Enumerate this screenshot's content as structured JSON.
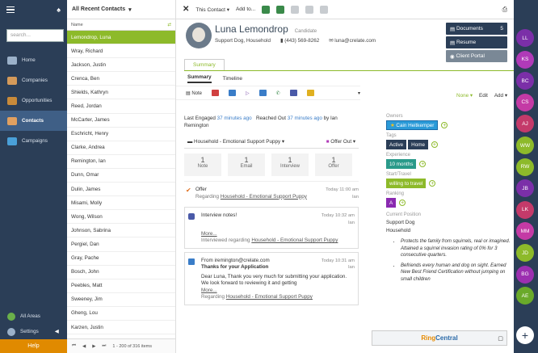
{
  "nav": {
    "search_placeholder": "search...",
    "items": [
      "Home",
      "Companies",
      "Opportunities",
      "Contacts",
      "Campaigns"
    ],
    "all_areas": "All Areas",
    "settings": "Settings",
    "help": "Help"
  },
  "list": {
    "title": "All Recent Contacts",
    "column": "Name",
    "rows": [
      "Lemondrop, Luna",
      "Wray, Richard",
      "Jackson, Justin",
      "Crenca, Ben",
      "Shields, Kathryn",
      "Reed, Jordan",
      "McCarter, James",
      "Eschricht, Henry",
      "Clarke, Andrea",
      "Remington, Ian",
      "Dunn, Omar",
      "Dulin, James",
      "Misami, Molly",
      "Wong, Wilson",
      "Johnson, Sabrina",
      "Pergiel, Dan",
      "Gray, Pache",
      "Bosch, John",
      "Peebles, Matt",
      "Sweeney, Jim",
      "Gheng, Lou",
      "Karzen, Justin"
    ],
    "pager": "1 - 200 of 316 items"
  },
  "toolbar": {
    "this_contact": "This Contact",
    "add_to": "Add to..."
  },
  "profile": {
    "name": "Luna Lemondrop",
    "status": "Candidate",
    "title": "Support Dog, Household",
    "mobile": "(443) 569-8262",
    "email": "luna@crelate.com"
  },
  "buttons": {
    "documents": "Documents",
    "documents_count": "5",
    "resume": "Resume",
    "portal": "Client Portal"
  },
  "tabs": {
    "summary": "Summary",
    "sub_summary": "Summary",
    "timeline": "Timeline"
  },
  "actions": {
    "note": "Note"
  },
  "engaged": {
    "label": "Last Engaged",
    "ago": "37 minutes ago",
    "reached": "Reached Out",
    "reached_ago": "37 minutes ago",
    "by": "by Ian Remington"
  },
  "deal": {
    "name": "Household - Emotional Support Puppy",
    "stage": "Offer Out"
  },
  "counts": [
    {
      "n": "1",
      "l": "Note"
    },
    {
      "n": "1",
      "l": "Email"
    },
    {
      "n": "1",
      "l": "Interview"
    },
    {
      "n": "1",
      "l": "Offer"
    }
  ],
  "events": [
    {
      "title": "Offer",
      "when": "Today 11:00 am",
      "who": "Ian",
      "sub": "Regarding",
      "link": "Household - Emotional Support Puppy"
    },
    {
      "title": "Interview notes!",
      "when": "Today 10:32 am",
      "who": "Ian",
      "more": "More...",
      "sub": "Interviewed regarding",
      "link": "Household - Emotional Support Puppy"
    },
    {
      "title": "From iremington@crelate.com",
      "when": "Today 10:31 am",
      "who": "Ian",
      "bold": "Thanks for your Application",
      "body": "Dear Luna,  Thank you very much for submitting your application. We look forward to reviewing it and getting",
      "more": "More...",
      "sub": "Regarding",
      "link": "Household - Emotional Support Puppy"
    }
  ],
  "right": {
    "none": "None",
    "edit": "Edit",
    "add": "Add",
    "owners_label": "Owners",
    "owner": "Cain Heitkemper",
    "tags_label": "Tags",
    "tags": [
      "Active",
      "Home"
    ],
    "experience_label": "Experience",
    "experience": "10 months",
    "start_label": "Start/Travel",
    "start": "willing to travel",
    "ranking_label": "Ranking",
    "ranking": "A",
    "position_label": "Current Position",
    "position1": "Support Dog",
    "position2": "Household",
    "bullets": [
      "Protects the family from squirrels, real or imagined. Attained a squirrel invasion rating of 0% for 3 consecutive quarters.",
      "Befriends every human and dog on sight. Earned New Best Friend Certification without jumping on small children"
    ]
  },
  "ringcentral": {
    "a": "Ring",
    "b": "Central"
  },
  "avatars": [
    {
      "i": "LL",
      "c": "#7b2fa8"
    },
    {
      "i": "KS",
      "c": "#b03ab8"
    },
    {
      "i": "BC",
      "c": "#7b2fa8"
    },
    {
      "i": "CS",
      "c": "#c43aa5"
    },
    {
      "i": "AJ",
      "c": "#c43a6a"
    },
    {
      "i": "WW",
      "c": "#8dba2a"
    },
    {
      "i": "RW",
      "c": "#8dba2a"
    },
    {
      "i": "JB",
      "c": "#7b2fa8"
    },
    {
      "i": "LK",
      "c": "#c43a6a"
    },
    {
      "i": "MM",
      "c": "#c43aa5"
    },
    {
      "i": "JD",
      "c": "#8dba2a"
    },
    {
      "i": "BG",
      "c": "#9c2fb0"
    },
    {
      "i": "AE",
      "c": "#6aaa2a"
    }
  ]
}
